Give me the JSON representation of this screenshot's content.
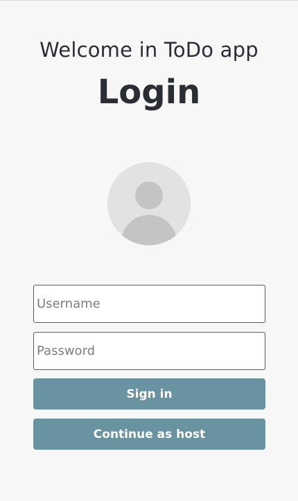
{
  "header": {
    "welcome": "Welcome in ToDo app",
    "title": "Login"
  },
  "avatar": {
    "icon": "user-avatar-icon"
  },
  "form": {
    "username_placeholder": "Username",
    "username_value": "",
    "password_placeholder": "Password",
    "password_value": "",
    "signin_label": "Sign in",
    "host_label": "Continue as host"
  },
  "colors": {
    "background": "#f7f7f7",
    "button": "#6a93a2",
    "avatar_bg": "#e2e2e2",
    "avatar_fg": "#c4c4c4"
  }
}
